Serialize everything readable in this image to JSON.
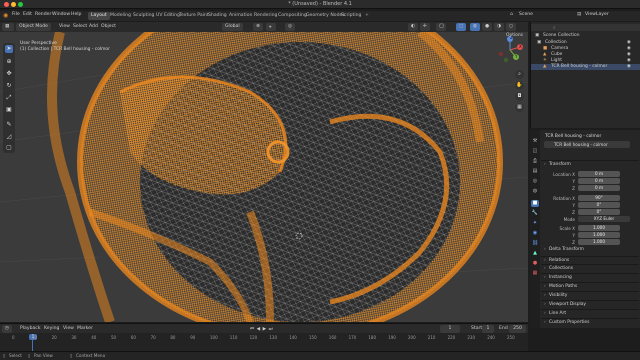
{
  "window": {
    "title": "* (Unsaved) - Blender 4.1"
  },
  "menu": {
    "items": [
      "File",
      "Edit",
      "Render",
      "Window",
      "Help"
    ],
    "workspaces": [
      "Layout",
      "Modeling",
      "Sculpting",
      "UV Editing",
      "Texture Paint",
      "Shading",
      "Animation",
      "Rendering",
      "Compositing",
      "Geometry Nodes",
      "Scripting"
    ],
    "scene_label": "Scene",
    "view_layer_label": "ViewLayer"
  },
  "viewport_header": {
    "mode": "Object Mode",
    "items": [
      "View",
      "Select",
      "Add",
      "Object"
    ],
    "orientation": "Global",
    "options_label": "Options"
  },
  "viewport": {
    "view_name": "User Perspective",
    "collection_info": "(1) Collection | TCR Bell housing - colmor",
    "gizmo": {
      "z": "Z",
      "y": "Y",
      "x": "X"
    }
  },
  "outliner": {
    "search_placeholder": "",
    "root": "Scene Collection",
    "collection": "Collection",
    "items": [
      "Camera",
      "Cube",
      "Light",
      "TCR Bell housing - colmor"
    ]
  },
  "properties": {
    "object_name": "TCR Bell housing - colmor",
    "object_field": "TCR Bell housing - colmor",
    "transform_label": "Transform",
    "location_label": "Location X",
    "location": [
      "0 m",
      "0 m",
      "0 m"
    ],
    "rotation_label": "Rotation X",
    "rotation": [
      "90°",
      "0°",
      "0°"
    ],
    "mode_label": "Mode",
    "mode_value": "XYZ Euler",
    "scale_label": "Scale X",
    "scale": [
      "1.000",
      "1.000",
      "1.000"
    ],
    "axis_labels": [
      "Y",
      "Z"
    ],
    "delta_transform": "Delta Transform",
    "panels": [
      "Relations",
      "Collections",
      "Instancing",
      "Motion Paths",
      "Visibility",
      "Viewport Display",
      "Line Art",
      "Custom Properties"
    ]
  },
  "timeline": {
    "menu": [
      "Playback",
      "Keying",
      "View",
      "Marker"
    ],
    "current_frame": "1",
    "start_label": "Start",
    "start": "1",
    "end_label": "End",
    "end": "250",
    "ticks": [
      "0",
      "10",
      "20",
      "30",
      "40",
      "50",
      "60",
      "70",
      "80",
      "90",
      "100",
      "110",
      "120",
      "130",
      "140",
      "150",
      "160",
      "170",
      "180",
      "190",
      "200",
      "210",
      "220",
      "230",
      "240",
      "250"
    ]
  },
  "status": {
    "select": "Select",
    "pan": "Pan View",
    "context": "Context Menu"
  },
  "colors": {
    "accent": "#4772b3",
    "wire": "#f08a1e",
    "selection_row": "#3a4a66"
  }
}
